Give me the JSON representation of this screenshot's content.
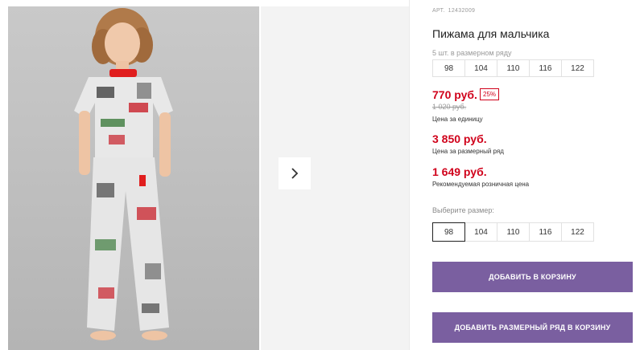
{
  "product": {
    "article_label": "АРТ.",
    "article_number": "12432009",
    "title": "Пижама для мальчика"
  },
  "size_row": {
    "hint": "5 шт. в размерном ряду",
    "sizes": [
      "98",
      "104",
      "110",
      "116",
      "122"
    ]
  },
  "prices": {
    "unit_price": "770 руб.",
    "discount": "25%",
    "old_price": "1 020 руб.",
    "unit_caption": "Цена за единицу",
    "row_price": "3 850 руб.",
    "row_caption": "Цена за размерный ряд",
    "rrp_price": "1 649 руб.",
    "rrp_caption": "Рекомендуемая розничная цена",
    "accent_color": "#d0021b"
  },
  "size_select": {
    "label": "Выберите размер:",
    "sizes": [
      "98",
      "104",
      "110",
      "116",
      "122"
    ],
    "selected": "98"
  },
  "actions": {
    "add_to_cart": "ДОБАВИТЬ В КОРЗИНУ",
    "add_row_to_cart": "ДОБАВИТЬ РАЗМЕРНЫЙ РЯД В КОРЗИНУ",
    "button_color": "#7a5fa0"
  },
  "gallery": {
    "main_photo_icon": "product-photo",
    "next_icon": "chevron-right-icon"
  }
}
